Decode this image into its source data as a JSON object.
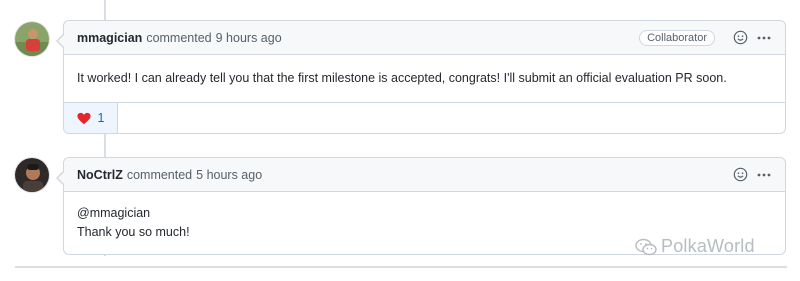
{
  "comments": [
    {
      "author": "mmagician",
      "verb": "commented",
      "time": "9 hours ago",
      "role_badge": "Collaborator",
      "body_lines": [
        "It worked! I can already tell you that the first milestone is accepted, congrats! I'll submit an official evaluation PR soon."
      ],
      "reactions": [
        {
          "emoji": "heart",
          "count": "1"
        }
      ]
    },
    {
      "author": "NoCtrlZ",
      "verb": "commented",
      "time": "5 hours ago",
      "body_lines": [
        "@mmagician",
        "Thank you so much!"
      ]
    }
  ],
  "watermark": {
    "text": "PolkaWorld"
  },
  "colors": {
    "link": "#0969da",
    "border": "#d0d7de",
    "header_bg": "#f6f8fa",
    "heart": "#e5242b"
  }
}
